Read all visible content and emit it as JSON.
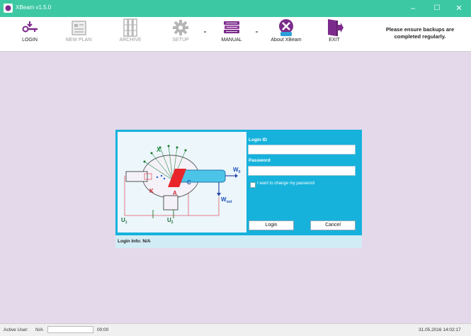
{
  "window": {
    "title": "XBeam v1.5.0",
    "minimize": "–",
    "maximize": "☐",
    "close": "✕"
  },
  "toolbar": {
    "items": [
      {
        "label": "LOGIN",
        "icon": "login-icon",
        "enabled": true
      },
      {
        "label": "NEW PLAN",
        "icon": "new-plan-icon",
        "enabled": false
      },
      {
        "label": "ARCHIVE",
        "icon": "archive-icon",
        "enabled": false
      },
      {
        "label": "SETUP",
        "icon": "gear-icon",
        "enabled": false
      },
      {
        "label": "MANUAL",
        "icon": "books-icon",
        "enabled": true
      },
      {
        "label": "About XBeam",
        "icon": "xbeam-logo-icon",
        "enabled": true
      },
      {
        "label": "EXIT",
        "icon": "exit-door-icon",
        "enabled": true
      }
    ],
    "notice_line1": "Please ensure backups are",
    "notice_line2": "completed regularly."
  },
  "diagram": {
    "label_x": "X",
    "label_k": "K",
    "label_a": "A",
    "label_c": "C",
    "label_w0": "W",
    "label_w0_sub": "0",
    "label_wout": "W",
    "label_wout_sub": "out",
    "label_u1": "U",
    "label_u1_sub": "1",
    "label_u2": "U",
    "label_u2_sub": "2"
  },
  "login": {
    "id_label": "Login ID",
    "password_label": "Password",
    "id_value": "",
    "password_value": "",
    "change_password_label": "I want to change my password",
    "login_button": "Login",
    "cancel_button": "Cancel",
    "info": "Login Info: N/A"
  },
  "status": {
    "active_user_label": "Active User:",
    "active_user_value": "N/A",
    "timer": "00:00",
    "datetime": "31.05.2016 14:02:17"
  },
  "colors": {
    "titlebar": "#3cc8a3",
    "workspace": "#e3d9ea",
    "dialog": "#16b2dc",
    "accent_purple": "#7b2b8b"
  }
}
